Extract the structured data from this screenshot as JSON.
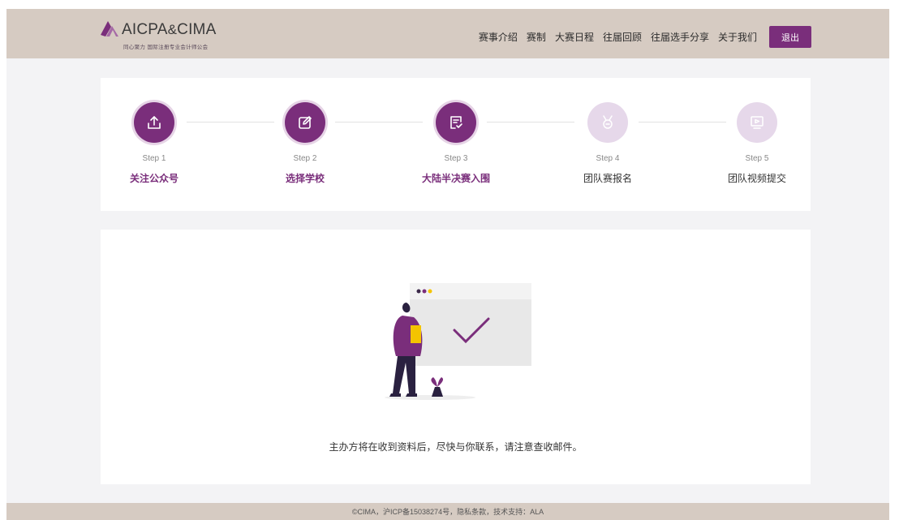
{
  "header": {
    "logo_text_main": "AICPA",
    "logo_text_amp": "&",
    "logo_text_cima": "CIMA",
    "logo_tagline": "同心聚力 国际注册专业会计师公会",
    "nav": [
      {
        "label": "赛事介绍"
      },
      {
        "label": "赛制"
      },
      {
        "label": "大赛日程"
      },
      {
        "label": "往届回顾"
      },
      {
        "label": "往届选手分享"
      },
      {
        "label": "关于我们"
      }
    ],
    "logout_label": "退出",
    "colors": {
      "bar": "#d6cbc2",
      "accent": "#7a2e7b"
    }
  },
  "steps": [
    {
      "num": "Step 1",
      "title": "关注公众号",
      "state": "active",
      "icon": "upload-icon"
    },
    {
      "num": "Step 2",
      "title": "选择学校",
      "state": "active",
      "icon": "edit-icon"
    },
    {
      "num": "Step 3",
      "title": "大陆半决赛入围",
      "state": "active",
      "icon": "checklist-icon"
    },
    {
      "num": "Step 4",
      "title": "团队赛报名",
      "state": "inactive",
      "icon": "medal-icon"
    },
    {
      "num": "Step 5",
      "title": "团队视频提交",
      "state": "inactive",
      "icon": "video-icon"
    }
  ],
  "content": {
    "message": "主办方将在收到资料后，尽快与你联系，请注意查收邮件。",
    "illustration": "person-holding-document-with-checkmark-illustration"
  },
  "footer": {
    "text": "©CIMA，沪ICP备15038274号，隐私条款，技术支持：ALA"
  }
}
